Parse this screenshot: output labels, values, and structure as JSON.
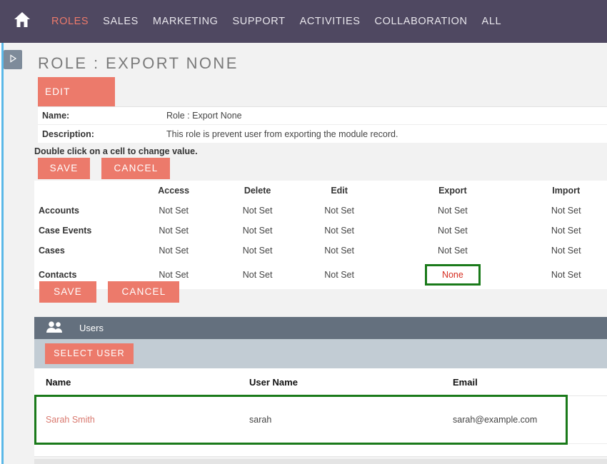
{
  "nav": {
    "home_icon": "home-icon",
    "items": [
      {
        "label": "ROLES",
        "active": true
      },
      {
        "label": "SALES",
        "active": false
      },
      {
        "label": "MARKETING",
        "active": false
      },
      {
        "label": "SUPPORT",
        "active": false
      },
      {
        "label": "ACTIVITIES",
        "active": false
      },
      {
        "label": "COLLABORATION",
        "active": false
      },
      {
        "label": "ALL",
        "active": false
      }
    ]
  },
  "sidebar": {
    "toggle_icon": "play-triangle-icon"
  },
  "page": {
    "title": "ROLE : EXPORT NONE",
    "edit_label": "EDIT",
    "hint": "Double click on a cell to change value.",
    "details": [
      {
        "label": "Name:",
        "value": "Role : Export None"
      },
      {
        "label": "Description:",
        "value": "This role is prevent user from exporting the module record."
      }
    ],
    "save_label": "SAVE",
    "cancel_label": "CANCEL"
  },
  "permissions": {
    "columns": [
      "",
      "Access",
      "Delete",
      "Edit",
      "Export",
      "Import"
    ],
    "rows": [
      {
        "module": "Accounts",
        "values": [
          "Not Set",
          "Not Set",
          "Not Set",
          "Not Set",
          "Not Set"
        ],
        "highlight_index": -1
      },
      {
        "module": "Case Events",
        "values": [
          "Not Set",
          "Not Set",
          "Not Set",
          "Not Set",
          "Not Set"
        ],
        "highlight_index": -1
      },
      {
        "module": "Cases",
        "values": [
          "Not Set",
          "Not Set",
          "Not Set",
          "Not Set",
          "Not Set"
        ],
        "highlight_index": -1
      },
      {
        "module": "Contacts",
        "values": [
          "Not Set",
          "Not Set",
          "Not Set",
          "None",
          "Not Set"
        ],
        "highlight_index": 3
      }
    ]
  },
  "users_panel": {
    "icon": "people-icon",
    "title": "Users",
    "select_user_label": "SELECT USER",
    "columns": [
      "Name",
      "User Name",
      "Email"
    ],
    "rows": [
      {
        "name": "Sarah Smith",
        "user_name": "sarah",
        "email": "sarah@example.com",
        "highlighted": true
      }
    ]
  },
  "colors": {
    "nav_background": "#4f4861",
    "accent": "#ec7a6b",
    "active_nav": "#ec7a6b",
    "highlight_border": "#1a7a1a",
    "none_value": "#d52b1e",
    "users_header": "#64707e",
    "users_toolbar": "#c2ccd4",
    "rail": "#5bb8e8"
  }
}
